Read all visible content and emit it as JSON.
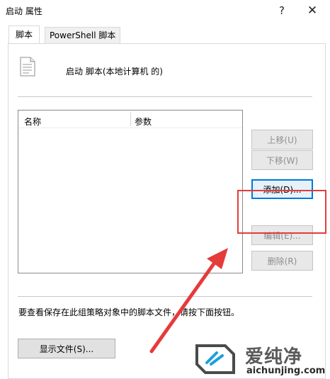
{
  "window": {
    "title": "启动 属性",
    "help_label": "?",
    "close_label": "✕"
  },
  "tabs": [
    {
      "label": "脚本",
      "active": true
    },
    {
      "label": "PowerShell 脚本",
      "active": false
    }
  ],
  "header": {
    "icon": "script-document-icon",
    "text": "启动 脚本(本地计算机 的)"
  },
  "script_list": {
    "columns": [
      "名称",
      "参数"
    ],
    "rows": []
  },
  "buttons": {
    "up": "上移(U)",
    "down": "下移(W)",
    "add": "添加(D)...",
    "edit": "编辑(E)...",
    "remove": "删除(R)",
    "show_files": "显示文件(S)..."
  },
  "hint_text": "要查看保存在此组策略对象中的脚本文件，请按下面按钮。",
  "annotation": {
    "highlight_color": "#e53b3b"
  },
  "watermark": {
    "name": "爱纯净",
    "url": "aichunjing.com",
    "color": "#5a5a5a"
  }
}
